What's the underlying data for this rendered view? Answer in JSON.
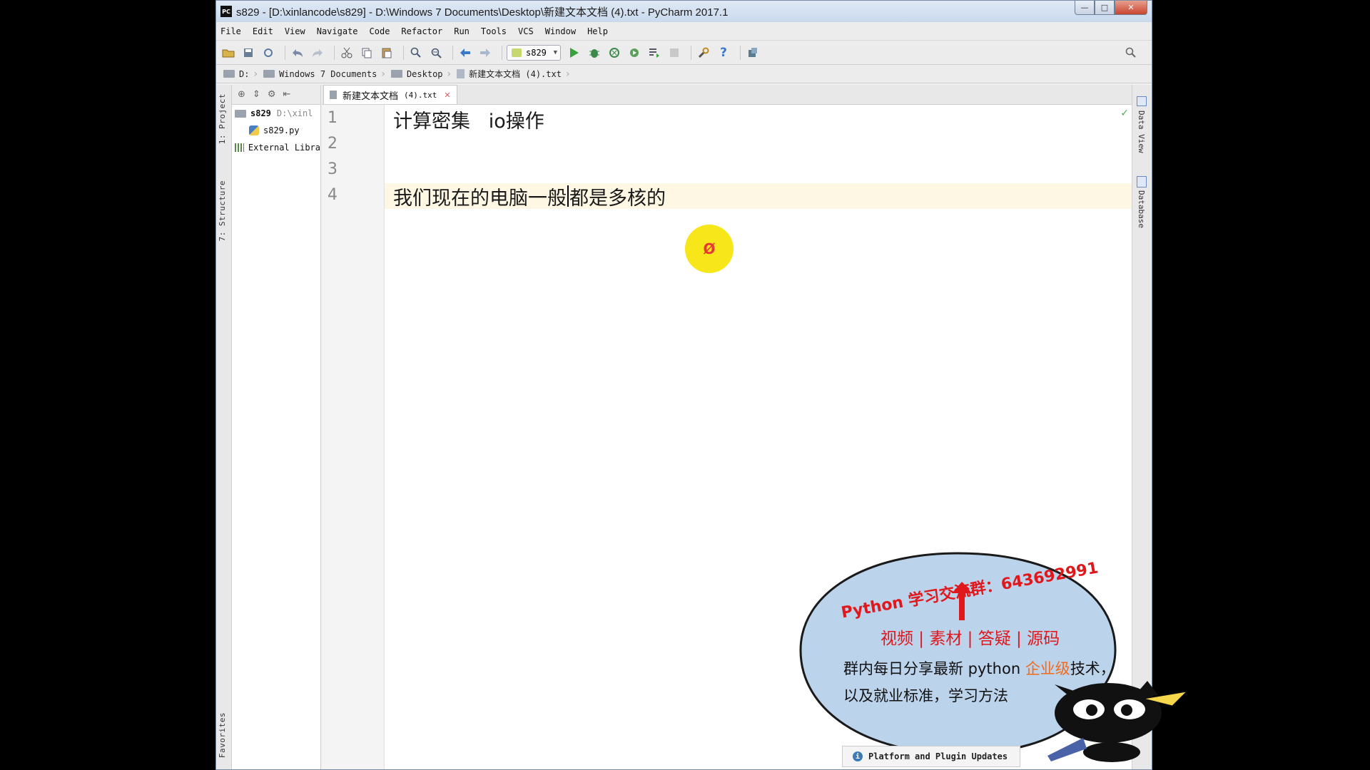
{
  "window": {
    "logo_text": "PC",
    "title": "s829 - [D:\\xinlancode\\s829] - D:\\Windows 7 Documents\\Desktop\\新建文本文档 (4).txt - PyCharm 2017.1",
    "controls": {
      "minimize": "—",
      "maximize": "□",
      "close": "✕"
    }
  },
  "menu": [
    "File",
    "Edit",
    "View",
    "Navigate",
    "Code",
    "Refactor",
    "Run",
    "Tools",
    "VCS",
    "Window",
    "Help"
  ],
  "toolbar": {
    "run_config": "s829",
    "help": "?"
  },
  "breadcrumb": [
    "D:",
    "Windows 7 Documents",
    "Desktop",
    "新建文本文档 (4).txt"
  ],
  "left_stripe": {
    "project_tab": "1: Project",
    "structure_tab": "7: Structure",
    "favorites_tab": "Favorites"
  },
  "project_tree": {
    "root_name": "s829",
    "root_path": "D:\\xinl",
    "file": "s829.py",
    "libraries": "External Libra"
  },
  "editor": {
    "tab_name": "新建文本文档",
    "tab_ext": "(4).txt",
    "tab_close": "✕",
    "line_numbers": [
      "1",
      "2",
      "3",
      "4"
    ],
    "line1": "计算密集   io操作",
    "line4_before_caret": "我们现在的电脑一般",
    "line4_after_caret": "都是多核的",
    "status_check": "✓"
  },
  "right_stripe": {
    "data_view": "Data View",
    "database": "Database"
  },
  "click_marker": "Ø",
  "promo": {
    "title": "Python 学习交流群：643692991",
    "tags": "视频 | 素材 | 答疑 | 源码",
    "line1_a": "群内每日分享最新 python ",
    "line1_highlight": "企业级",
    "line1_b": "技术，",
    "line2": "以及就业标准，学习方法"
  },
  "notification": {
    "text": "Platform and Plugin Updates"
  },
  "colors": {
    "current_line": "#fdf7e3",
    "promo_red": "#e0181c",
    "highlight_orange": "#f26a1b",
    "bubble_fill": "#bcd3ec"
  }
}
